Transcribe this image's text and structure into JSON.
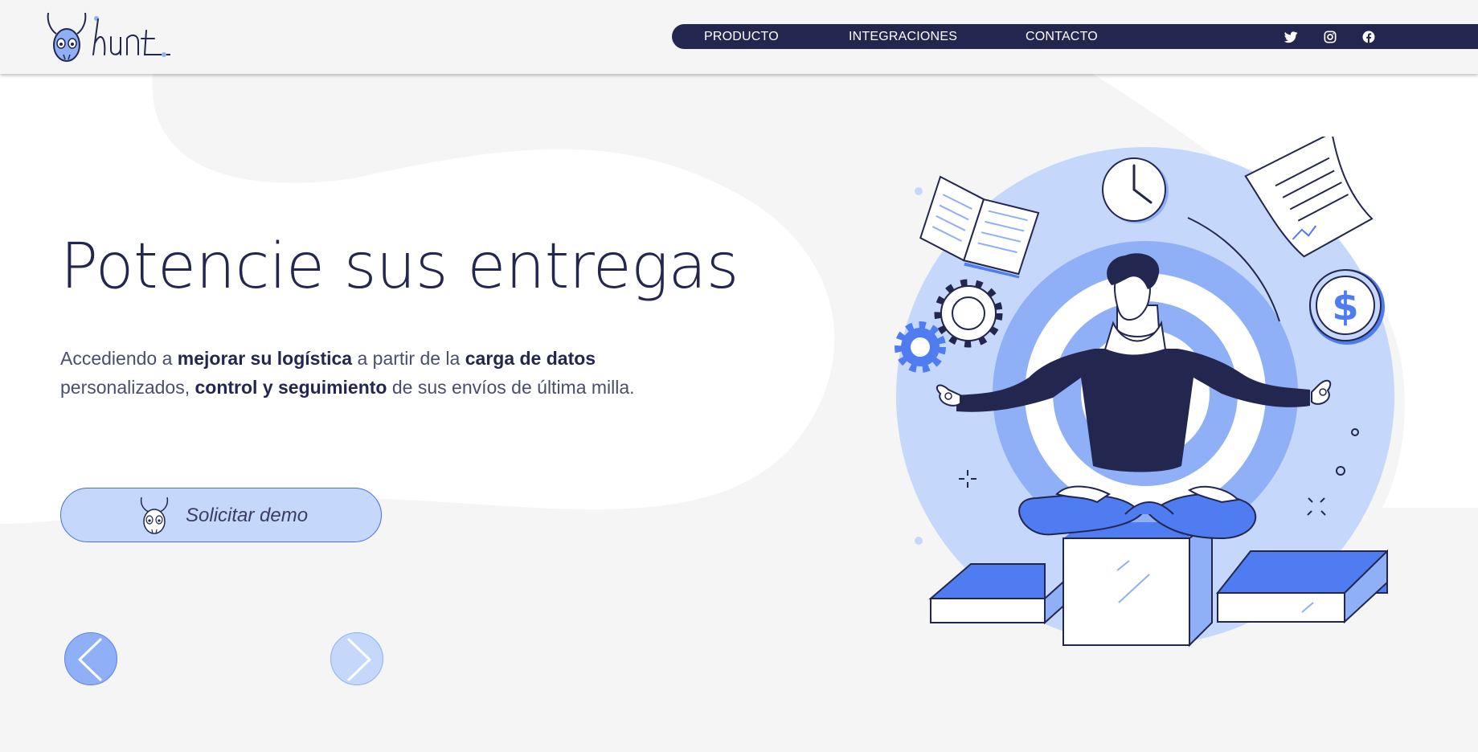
{
  "brand": {
    "name": "hunt"
  },
  "nav": {
    "items": [
      {
        "label": "PRODUCTO"
      },
      {
        "label": "INTEGRACIONES"
      },
      {
        "label": "CONTACTO"
      }
    ],
    "social": [
      "twitter-icon",
      "instagram-icon",
      "facebook-icon"
    ]
  },
  "hero": {
    "title": "Potencie sus entregas",
    "text": {
      "p1": "Accediendo a ",
      "b1": "mejorar su logística",
      "p2": " a partir de la ",
      "b2": "carga de datos",
      "p3": " personalizados, ",
      "b3": "control y seguimiento",
      "p4": " de sus envíos de última milla."
    },
    "cta_label": "Solicitar demo"
  },
  "carousel": {
    "prev_icon": "chevron-left-icon",
    "next_icon": "chevron-right-icon"
  },
  "colors": {
    "navy": "#232750",
    "accent": "#4f7cf1",
    "light_accent": "#c5d7fb",
    "background": "#f5f5f5"
  }
}
